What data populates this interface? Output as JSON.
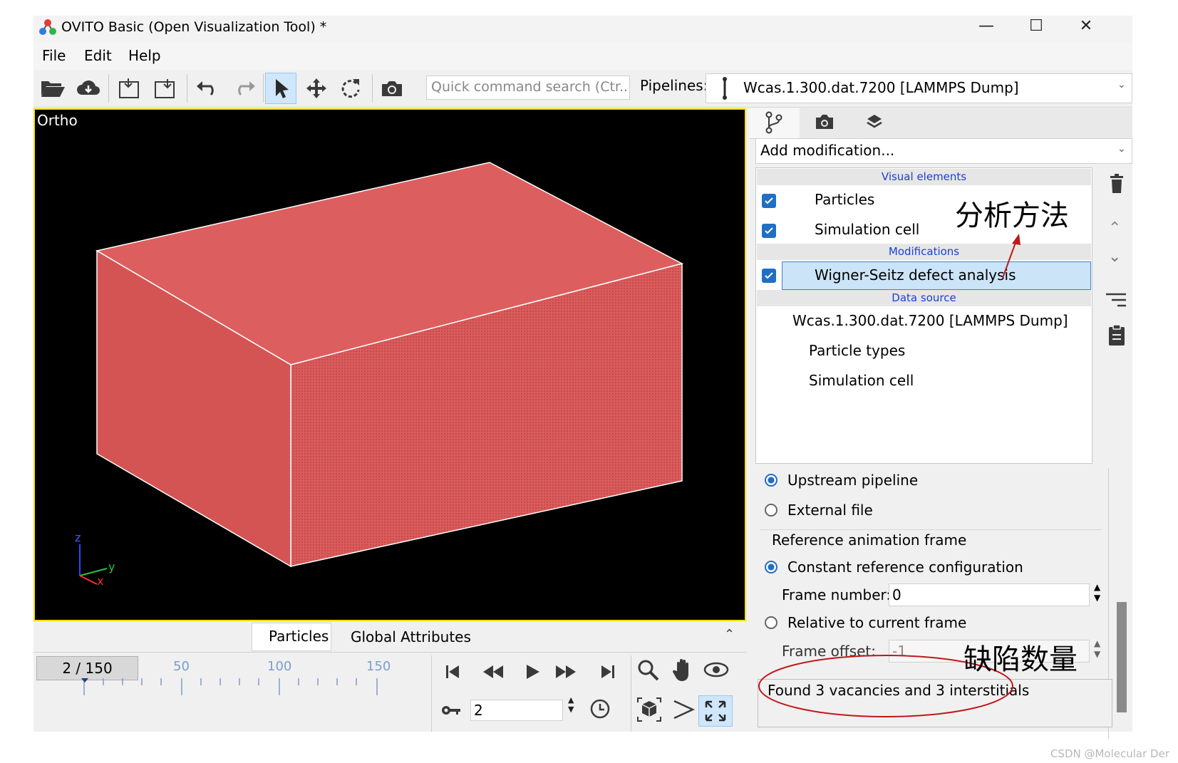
{
  "window": {
    "title": "OVITO Basic (Open Visualization Tool) *",
    "controls": {
      "minimize": "—",
      "maximize": "☐",
      "close": "✕"
    }
  },
  "menu": {
    "file": "File",
    "edit": "Edit",
    "help": "Help"
  },
  "toolbar": {
    "search_placeholder": "Quick command search (Ctr...",
    "pipelines_label": "Pipelines:",
    "pipeline_selected": "Wcas.1.300.dat.7200 [LAMMPS Dump]"
  },
  "viewport": {
    "label": "Ortho",
    "axes": {
      "z": "z",
      "y": "y",
      "x": "x"
    },
    "box_color": "#d65050"
  },
  "bottom_tabs": {
    "particles": "Particles",
    "global_attributes": "Global Attributes"
  },
  "timeline": {
    "frame_display": "2 / 150",
    "ticks": [
      "50",
      "100",
      "150"
    ]
  },
  "animation": {
    "current_frame": "2"
  },
  "right_panel": {
    "add_modification": "Add modification...",
    "sections": {
      "visual": "Visual elements",
      "modifications": "Modifications",
      "data_source": "Data source"
    },
    "visual_items": [
      "Particles",
      "Simulation cell"
    ],
    "modification_item": "Wigner-Seitz defect analysis",
    "data_items": [
      "Wcas.1.300.dat.7200 [LAMMPS Dump]",
      "Particle types",
      "Simulation cell"
    ]
  },
  "params": {
    "upstream": "Upstream pipeline",
    "external": "External file",
    "ref_frame_group": "Reference animation frame",
    "constant": "Constant reference configuration",
    "frame_number_label": "Frame number:",
    "frame_number": "0",
    "relative": "Relative to current frame",
    "frame_offset_label": "Frame offset:",
    "frame_offset": "-1"
  },
  "status_text": "Found 3 vacancies and 3 interstitials",
  "annotations": {
    "method": "分析方法",
    "defects": "缺陷数量",
    "accent": "#c0181a"
  },
  "watermark": "CSDN @Molecular Der"
}
